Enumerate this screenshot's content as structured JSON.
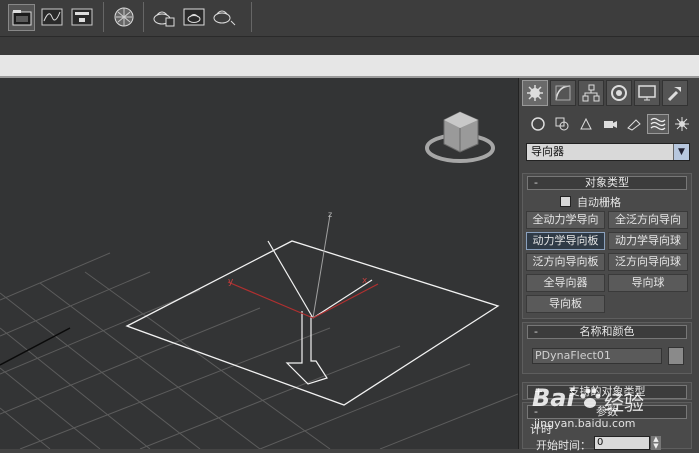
{
  "toolbar": {
    "icons": [
      "open-folder-icon",
      "curve-editor-icon",
      "schematic-view-icon",
      "material-editor-icon",
      "render-setup-icon",
      "rendered-frame-icon",
      "render-production-icon"
    ]
  },
  "viewport": {
    "axis_labels": {
      "x": "x",
      "y": "y",
      "z": "z"
    }
  },
  "command_panel": {
    "tabs": [
      "create-tab",
      "modify-tab",
      "hierarchy-tab",
      "motion-tab",
      "display-tab",
      "utilities-tab"
    ],
    "subtabs": [
      "geometry-subtab",
      "shapes-subtab",
      "lights-subtab",
      "cameras-subtab",
      "helpers-subtab",
      "space-warps-subtab",
      "systems-subtab"
    ],
    "category_dropdown": {
      "selected": "导向器"
    },
    "object_type": {
      "title": "对象类型",
      "collapse_sign": "-",
      "autogrid_label": "自动栅格",
      "buttons": [
        "全动力学导向",
        "全泛方向导向",
        "动力学导向板",
        "动力学导向球",
        "泛方向导向板",
        "泛方向导向球",
        "全导向器",
        "导向球",
        "导向板"
      ],
      "active_button": "动力学导向板"
    },
    "name_color": {
      "title": "名称和颜色",
      "collapse_sign": "-",
      "name_value": "PDynaFlect01",
      "color": "#8a8a8a"
    },
    "supported_types": {
      "title": "支持的对象类型",
      "collapse_sign": "+"
    },
    "parameters": {
      "title": "参数",
      "collapse_sign": "-",
      "timing_label": "计时",
      "start_time_label": "开始时间：",
      "start_time_value": "0"
    }
  },
  "watermark": {
    "logo_text": "Bai",
    "logo_suffix": "经验",
    "url": "jingyan.baidu.com"
  },
  "colors": {
    "accent": "#8aa0bd",
    "x_axis": "#b03030",
    "viewport_bg": "#333435",
    "panel_bg": "#444444"
  }
}
